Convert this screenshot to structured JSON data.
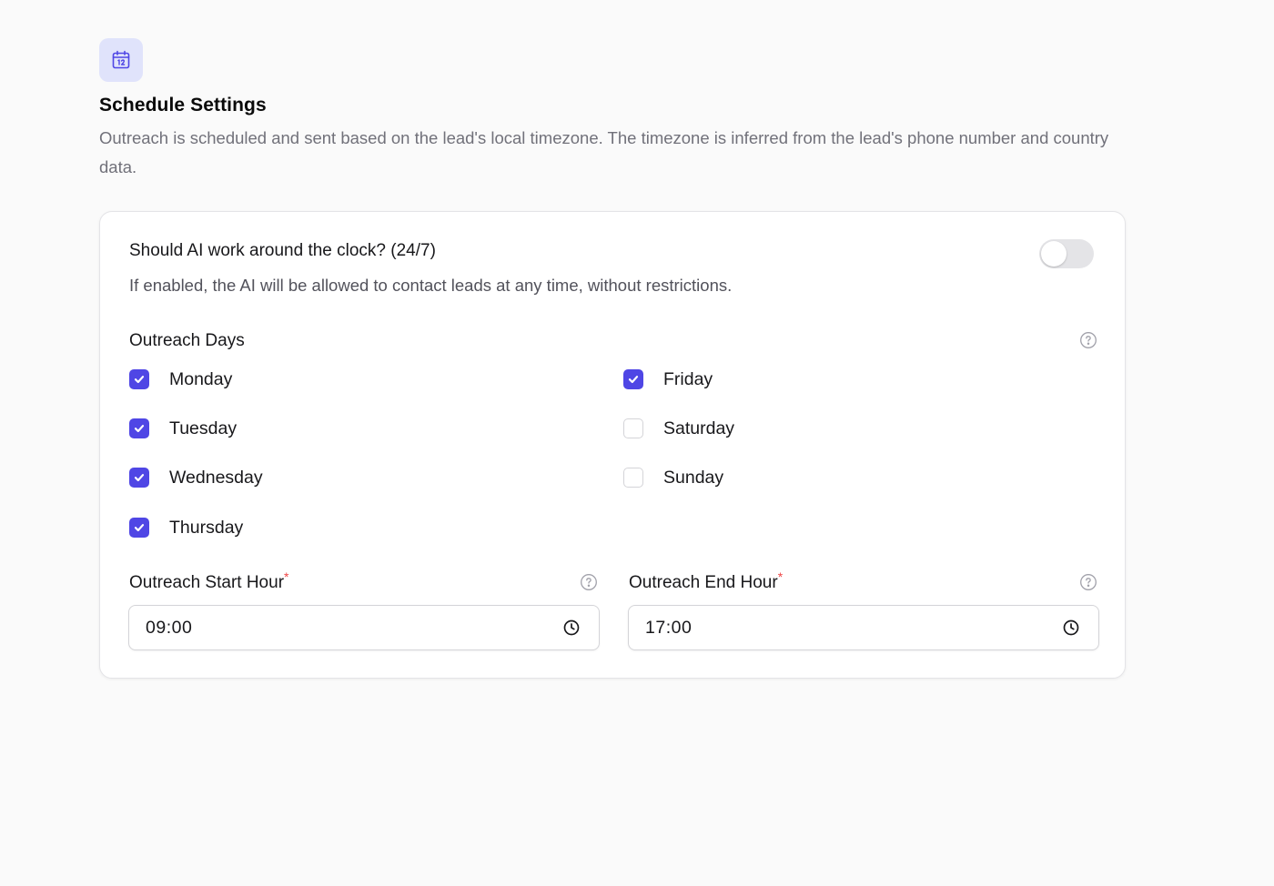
{
  "header": {
    "icon": "calendar-icon",
    "title": "Schedule Settings",
    "description": "Outreach is scheduled and sent based on the lead's local timezone. The timezone is inferred from the lead's phone number and country data."
  },
  "around_clock": {
    "title": "Should AI work around the clock? (24/7)",
    "description": "If enabled, the AI will be allowed to contact leads at any time, without restrictions.",
    "enabled": false
  },
  "outreach_days": {
    "label": "Outreach Days",
    "days": [
      {
        "label": "Monday",
        "checked": true
      },
      {
        "label": "Tuesday",
        "checked": true
      },
      {
        "label": "Wednesday",
        "checked": true
      },
      {
        "label": "Thursday",
        "checked": true
      },
      {
        "label": "Friday",
        "checked": true
      },
      {
        "label": "Saturday",
        "checked": false
      },
      {
        "label": "Sunday",
        "checked": false
      }
    ]
  },
  "start_hour": {
    "label": "Outreach Start Hour",
    "required_mark": "*",
    "value": "09:00"
  },
  "end_hour": {
    "label": "Outreach End Hour",
    "required_mark": "*",
    "value": "17:00"
  },
  "colors": {
    "accent": "#4f46e5",
    "icon_bg": "#e0e3fb",
    "required": "#ef4444"
  }
}
